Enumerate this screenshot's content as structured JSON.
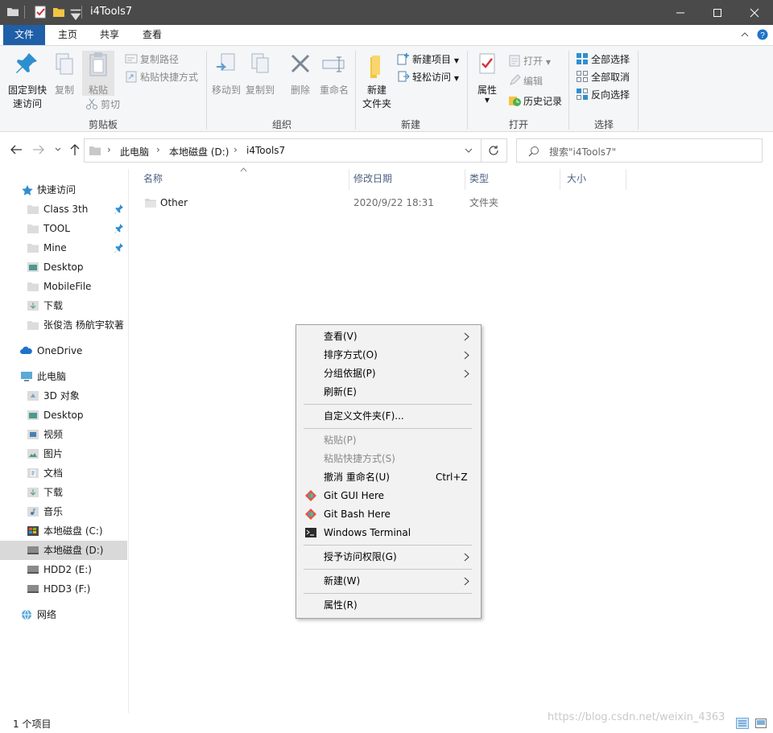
{
  "window": {
    "title": "i4Tools7",
    "controls": [
      "minimize",
      "maximize",
      "close"
    ]
  },
  "tabs": [
    {
      "label": "文件",
      "active": true
    },
    {
      "label": "主页",
      "active": false
    },
    {
      "label": "共享",
      "active": false
    },
    {
      "label": "查看",
      "active": false
    }
  ],
  "ribbon": {
    "clipboard": {
      "group_label": "剪贴板",
      "pin_label_1": "固定到快",
      "pin_label_2": "速访问",
      "copy_label": "复制",
      "paste_label": "粘贴",
      "copy_path_label": "复制路径",
      "paste_shortcut_label": "粘贴快捷方式",
      "cut_label": "剪切"
    },
    "organize": {
      "group_label": "组织",
      "move_to_label": "移动到",
      "copy_to_label": "复制到",
      "delete_label": "删除",
      "rename_label": "重命名"
    },
    "new": {
      "group_label": "新建",
      "new_folder_label_1": "新建",
      "new_folder_label_2": "文件夹",
      "new_item_label": "新建项目",
      "easy_access_label": "轻松访问"
    },
    "open": {
      "group_label": "打开",
      "properties_label": "属性",
      "open_label": "打开",
      "edit_label": "编辑",
      "history_label": "历史记录"
    },
    "select": {
      "group_label": "选择",
      "select_all_label": "全部选择",
      "select_none_label": "全部取消",
      "invert_label": "反向选择"
    }
  },
  "address": {
    "crumbs": [
      "此电脑",
      "本地磁盘 (D:)",
      "i4Tools7"
    ],
    "search_placeholder": "搜索\"i4Tools7\""
  },
  "nav": {
    "quick_access": "快速访问",
    "quick_items": [
      {
        "label": "Class 3th",
        "pinned": true
      },
      {
        "label": "TOOL",
        "pinned": true
      },
      {
        "label": "Mine",
        "pinned": true
      },
      {
        "label": "Desktop",
        "pinned": false
      },
      {
        "label": "MobileFile",
        "pinned": false
      },
      {
        "label": "下载",
        "pinned": false
      },
      {
        "label": "张俊浩 杨航宇软著",
        "pinned": false
      }
    ],
    "onedrive": "OneDrive",
    "this_pc": "此电脑",
    "pc_items": [
      {
        "label": "3D 对象",
        "selected": false
      },
      {
        "label": "Desktop",
        "selected": false
      },
      {
        "label": "视频",
        "selected": false
      },
      {
        "label": "图片",
        "selected": false
      },
      {
        "label": "文档",
        "selected": false
      },
      {
        "label": "下载",
        "selected": false
      },
      {
        "label": "音乐",
        "selected": false
      },
      {
        "label": "本地磁盘 (C:)",
        "selected": false
      },
      {
        "label": "本地磁盘 (D:)",
        "selected": true
      },
      {
        "label": "HDD2 (E:)",
        "selected": false
      },
      {
        "label": "HDD3 (F:)",
        "selected": false
      }
    ],
    "network": "网络"
  },
  "columns": {
    "name": "名称",
    "date": "修改日期",
    "type": "类型",
    "size": "大小"
  },
  "files": [
    {
      "name": "Other",
      "date": "2020/9/22 18:31",
      "type": "文件夹",
      "size": ""
    }
  ],
  "status": {
    "count": "1 个项目",
    "watermark": "https://blog.csdn.net/weixin_4363"
  },
  "context_menu": {
    "view": "查看(V)",
    "sort": "排序方式(O)",
    "group": "分组依据(P)",
    "refresh": "刷新(E)",
    "customize": "自定义文件夹(F)...",
    "paste": "粘贴(P)",
    "paste_shortcut": "粘贴快捷方式(S)",
    "undo": "撤消 重命名(U)",
    "undo_shortcut": "Ctrl+Z",
    "git_gui": "Git GUI Here",
    "git_bash": "Git Bash Here",
    "terminal": "Windows Terminal",
    "give_access": "授予访问权限(G)",
    "new": "新建(W)",
    "properties": "属性(R)"
  },
  "colors": {
    "titlebar": "#4a4a4a",
    "file_tab": "#1f5fa8",
    "selected_nav": "#d9d9d9",
    "menu_bg": "#f2f2f2"
  }
}
